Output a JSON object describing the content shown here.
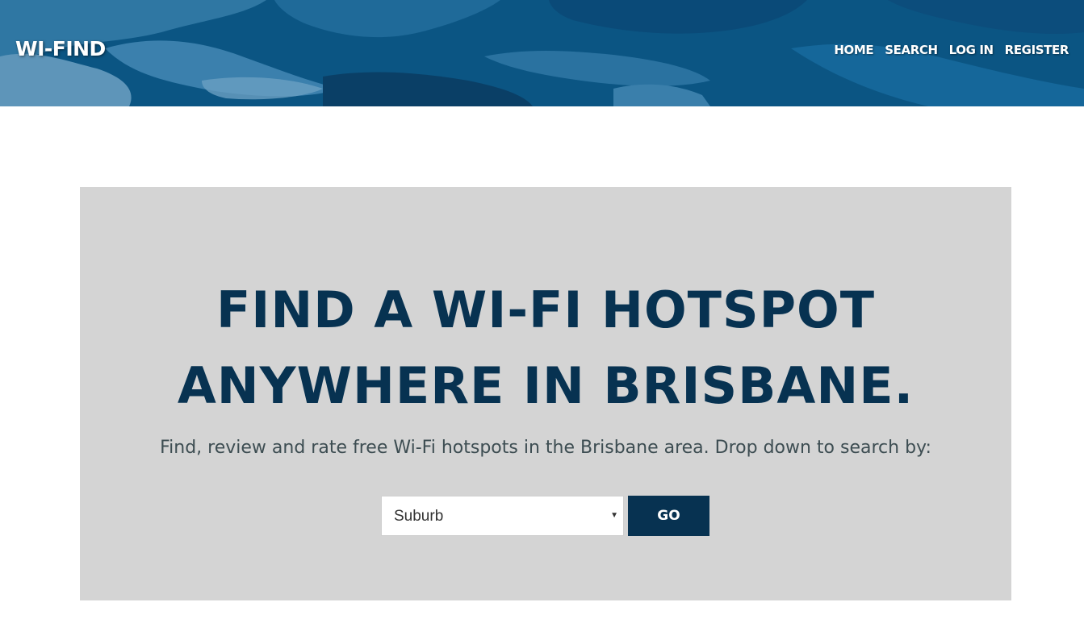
{
  "header": {
    "logo": "WI-FIND",
    "nav": [
      "HOME",
      "SEARCH",
      "LOG IN",
      "REGISTER"
    ]
  },
  "hero": {
    "headline_line1": "FIND A WI-FI HOTSPOT",
    "headline_line2": "ANYWHERE IN BRISBANE.",
    "subtitle": "Find, review and rate free Wi-Fi hotspots in the Brisbane area. Drop down to search by:",
    "select_value": "Suburb",
    "go_label": "GO"
  },
  "colors": {
    "header_blue": "#0a4f7d",
    "dark_navy": "#073251",
    "hero_gray": "#d4d4d4"
  }
}
